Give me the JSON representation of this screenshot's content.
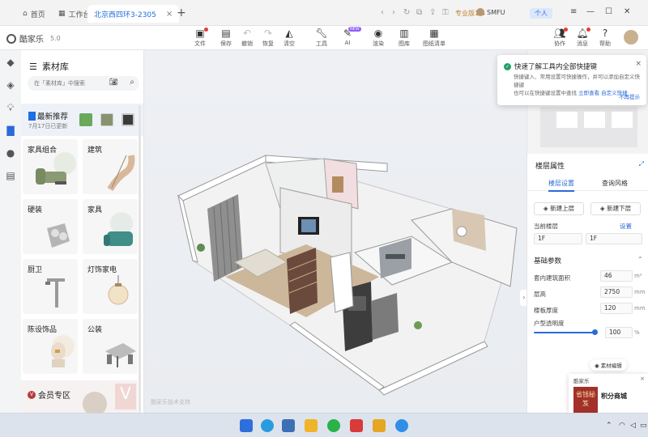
{
  "browser": {
    "tabs": [
      {
        "label": "首页"
      },
      {
        "label": "工作台"
      },
      {
        "label": "北京西四环3-2305"
      }
    ],
    "plan_badge": "专业版1.6",
    "username": "SMFU",
    "personal": "个人"
  },
  "toolbar": {
    "brand": "酷家乐",
    "version": "5.0",
    "tools": [
      {
        "label": "文件",
        "icon": "file-icon"
      },
      {
        "label": "保存",
        "icon": "save-icon"
      },
      {
        "label": "撤销",
        "icon": "undo-icon"
      },
      {
        "label": "恢复",
        "icon": "redo-icon"
      },
      {
        "label": "清空",
        "icon": "eraser-icon"
      },
      {
        "label": "工具",
        "icon": "wrench-icon"
      },
      {
        "label": "AI",
        "icon": "ai-icon"
      },
      {
        "label": "渲染",
        "icon": "camera-icon"
      },
      {
        "label": "图库",
        "icon": "gallery-icon"
      },
      {
        "label": "图纸清单",
        "icon": "drawing-list-icon"
      }
    ],
    "ai_badge": "NEW",
    "right_tools": [
      {
        "label": "协作",
        "icon": "collab-icon"
      },
      {
        "label": "消息",
        "icon": "bell-icon"
      },
      {
        "label": "帮助",
        "icon": "help-icon"
      }
    ]
  },
  "library": {
    "title": "素材库",
    "search_placeholder": "在「素材库」中搜索",
    "recommend_title": "最新推荐",
    "recommend_date": "7月17日已更新",
    "categories": [
      {
        "label": "家具组合"
      },
      {
        "label": "建筑"
      },
      {
        "label": "硬装"
      },
      {
        "label": "家具"
      },
      {
        "label": "厨卫"
      },
      {
        "label": "灯饰家电"
      },
      {
        "label": "陈设饰品"
      },
      {
        "label": "公装"
      }
    ],
    "vip_label": "会员专区"
  },
  "canvas": {
    "watermark": "酷家乐技术支持"
  },
  "properties": {
    "title": "楼层属性",
    "tabs": [
      {
        "label": "楼层设置"
      },
      {
        "label": "查询风格"
      }
    ],
    "add_above": "新建上层",
    "add_below": "新建下层",
    "current_floor_label": "当前楼层",
    "floor_setting_link": "设置",
    "floor_from": "1F",
    "floor_to": "1F",
    "section_title": "基础参数",
    "rows": [
      {
        "label": "套内建筑面积",
        "value": "46",
        "unit": "m²"
      },
      {
        "label": "层高",
        "value": "2750",
        "unit": "mm"
      },
      {
        "label": "楼板厚度",
        "value": "120",
        "unit": "mm"
      },
      {
        "label": "户型透明度",
        "value": "100",
        "unit": "%"
      }
    ],
    "opacity_fraction": 1.0
  },
  "notification": {
    "title": "快速了解工具内全部快捷键",
    "body_1": "快捷键入、常用设置可快捷操作，并可以添加自定义快捷键",
    "body_2": "也可以在快捷键设置中查找",
    "link_1": "立即查看",
    "link_2": "自定义快捷",
    "more": "不再提示"
  },
  "popup": {
    "pill": "素材编辑",
    "ad_header": "酷家乐",
    "ad_image_text": "省钱秘笈",
    "ad_text": "积分商城"
  },
  "colors": {
    "accent": "#2b6ad9",
    "wall": "#ffffff",
    "floor_wood": "#8a6a4f"
  }
}
